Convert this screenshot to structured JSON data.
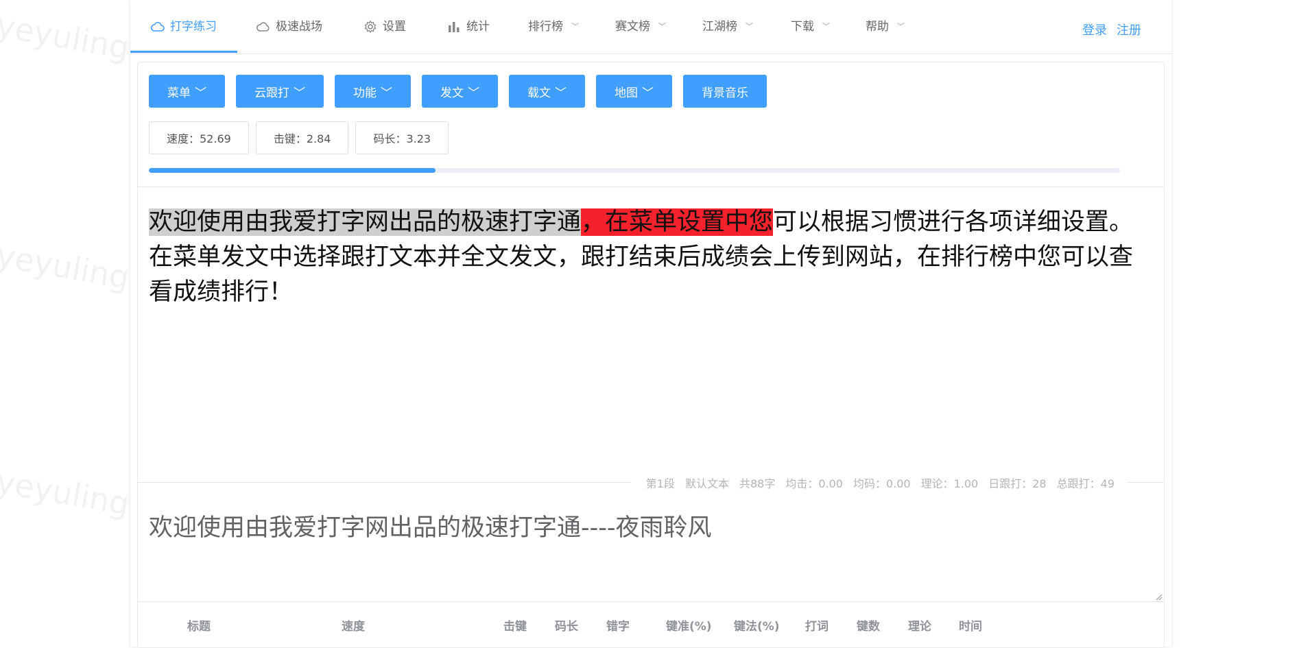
{
  "watermark": "yeyulingfeng.com",
  "nav": {
    "items": [
      {
        "label": "打字练习",
        "icon": "cloud-icon"
      },
      {
        "label": "极速战场",
        "icon": "cloud-outline-icon"
      },
      {
        "label": "设置",
        "icon": "gear-icon"
      },
      {
        "label": "统计",
        "icon": "bar-chart-icon"
      },
      {
        "label": "排行榜"
      },
      {
        "label": "赛文榜"
      },
      {
        "label": "江湖榜"
      },
      {
        "label": "下载"
      },
      {
        "label": "帮助"
      }
    ],
    "login": "登录",
    "register": "注册"
  },
  "toolbar": {
    "buttons": [
      "菜单",
      "云跟打",
      "功能",
      "发文",
      "载文",
      "地图",
      "背景音乐"
    ]
  },
  "stats": {
    "speed": "速度：52.69",
    "keystroke": "击键：2.84",
    "code_length": "码长：3.23"
  },
  "progress": {
    "fraction": 0.295
  },
  "article": {
    "typed": "欢迎使用由我爱打字网出品的极速打字通",
    "error": "，在菜单设置中您",
    "rest": "可以根据习惯进行各项详细设置。在菜单发文中选择跟打文本并全文发文，跟打结束后成绩会上传到网站，在排行榜中您可以查看成绩排行！"
  },
  "info": {
    "segment": "第1段",
    "text_name": "默认文本",
    "char_count": "共88字",
    "avg_keystroke": "均击：0.00",
    "avg_code": "均码：0.00",
    "theory": "理论：1.00",
    "daily": "日跟打：28",
    "total": "总跟打：49"
  },
  "input": {
    "value": "欢迎使用由我爱打字网出品的极速打字通----夜雨聆风"
  },
  "table": {
    "headers": [
      "标题",
      "速度",
      "击键",
      "码长",
      "错字",
      "键准(%)",
      "键法(%)",
      "打词",
      "键数",
      "理论",
      "时间"
    ]
  },
  "colors": {
    "accent": "#409eff",
    "error": "#f5222d",
    "typed": "#cfcfcf"
  }
}
